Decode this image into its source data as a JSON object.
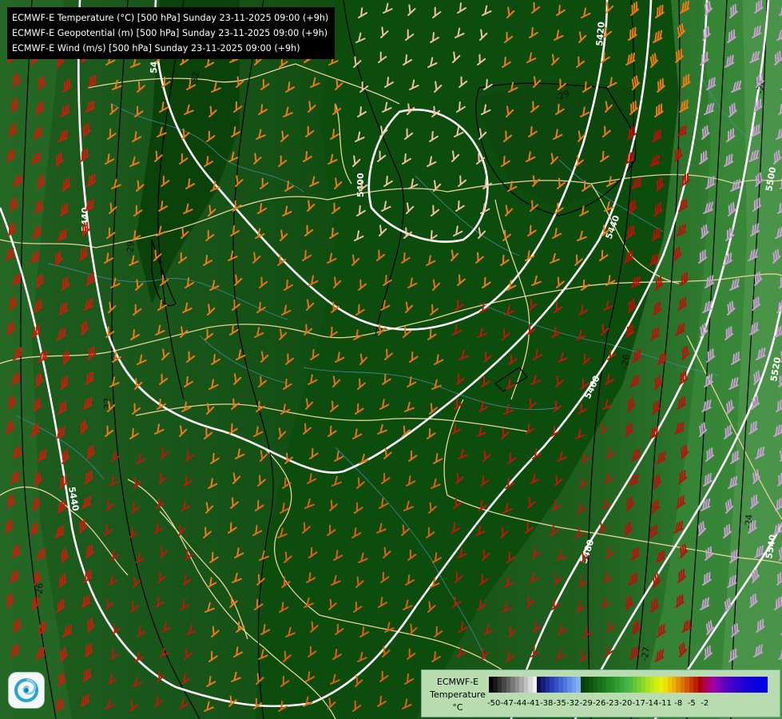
{
  "titles": [
    "ECMWF-E Temperature (°C) [500 hPa] Sunday 23-11-2025 09:00 (+9h)",
    "ECMWF-E Geopotential (m) [500 hPa] Sunday 23-11-2025 09:00 (+9h)",
    "ECMWF-E Wind (m/s) [500 hPa] Sunday 23-11-2025 09:00 (+9h)"
  ],
  "logo": {
    "icon": "swirl-logo-icon"
  },
  "legend": {
    "model": "ECMWF-E",
    "variable": "Temperature",
    "unit": "°C",
    "ticks": [
      "-50",
      "-47",
      "-44",
      "-41",
      "-38",
      "-35",
      "-32",
      "-29",
      "-26",
      "-23",
      "-20",
      "-17",
      "-14",
      "-11",
      "-8",
      "-5",
      "-2"
    ],
    "colors": [
      "#000000",
      "#181818",
      "#303030",
      "#484848",
      "#606060",
      "#787878",
      "#909090",
      "#a8a8a8",
      "#c0c0c0",
      "#d8d8d8",
      "#f0f0f0",
      "#0a0a50",
      "#141e78",
      "#1e2d96",
      "#283cb4",
      "#3250c8",
      "#4164d2",
      "#5078dc",
      "#608ce6",
      "#70a0ec",
      "#80b4f2",
      "#083e08",
      "#0c4a0c",
      "#105610",
      "#146214",
      "#196e19",
      "#1e7a1e",
      "#248624",
      "#2a922a",
      "#329e32",
      "#3aa83a",
      "#44b244",
      "#50bc40",
      "#62c638",
      "#78d030",
      "#8ed828",
      "#a6e020",
      "#bee818",
      "#d4ee10",
      "#e6f00c",
      "#f0e00a",
      "#f0c808",
      "#ecae08",
      "#e69208",
      "#de7408",
      "#d45608",
      "#c83a08",
      "#bc1e08",
      "#b00010",
      "#b0004a",
      "#a8007a",
      "#a000a0",
      "#8800b4",
      "#7000be",
      "#5a00c4",
      "#4800c8",
      "#3800cc",
      "#2c00d0",
      "#2000d4",
      "#1800d8",
      "#1000dc",
      "#0800e0",
      "#0000e4",
      "#0000e8"
    ]
  },
  "contour_labels": {
    "geopotential": [
      "5420",
      "5400",
      "5440",
      "5440",
      "5460",
      "5480",
      "5500",
      "5520",
      "5540",
      "5440",
      "5400",
      "54"
    ],
    "temperature": [
      "-29",
      "-29",
      "-32",
      "-26",
      "-26",
      "-32",
      "-24",
      "-26",
      "-27",
      "-32",
      "-33",
      "-32"
    ]
  },
  "colors": {
    "shading_dark": "#0a4a0a",
    "shading_mid": "#1a641a",
    "shading_light": "#3a8a3a",
    "geopotential_contour": "#ffffff",
    "temperature_contour": "#000000",
    "borders": "#e8d49a",
    "rivers": "#4a8fb0"
  }
}
